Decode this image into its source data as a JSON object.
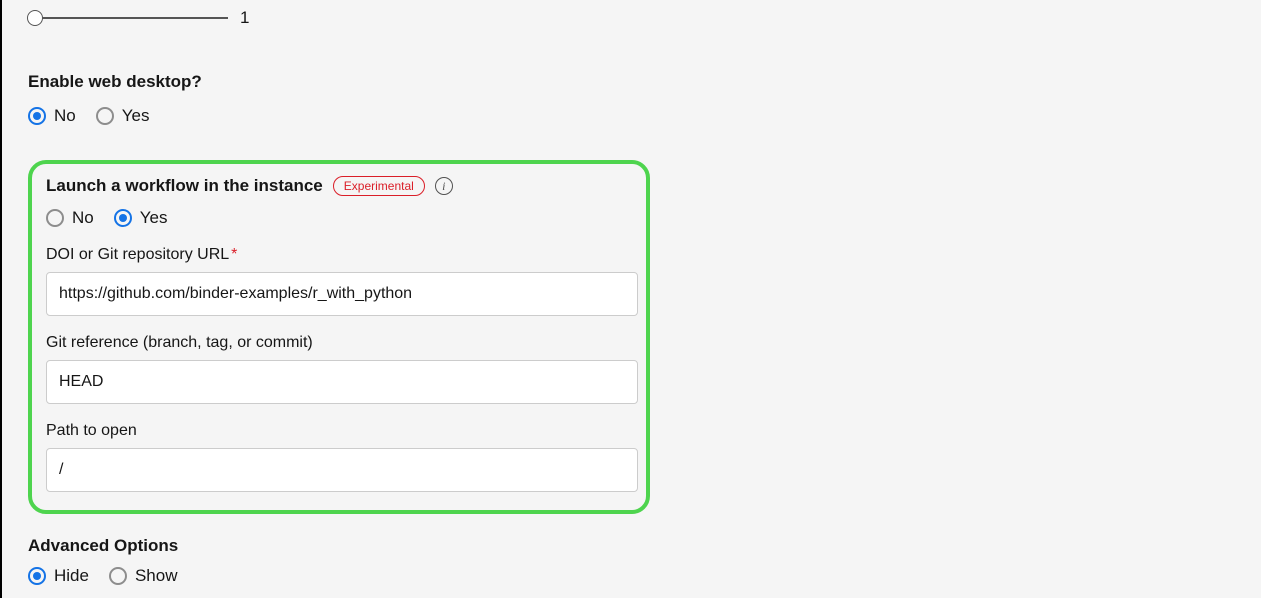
{
  "slider": {
    "value_label": "1"
  },
  "web_desktop": {
    "question": "Enable web desktop?",
    "no_label": "No",
    "yes_label": "Yes"
  },
  "workflow": {
    "title": "Launch a workflow in the instance",
    "badge": "Experimental",
    "no_label": "No",
    "yes_label": "Yes",
    "doi_label": "DOI or Git repository URL",
    "doi_value": "https://github.com/binder-examples/r_with_python",
    "gitref_label": "Git reference (branch, tag, or commit)",
    "gitref_value": "HEAD",
    "path_label": "Path to open",
    "path_value": "/"
  },
  "advanced": {
    "title": "Advanced Options",
    "hide_label": "Hide",
    "show_label": "Show"
  }
}
